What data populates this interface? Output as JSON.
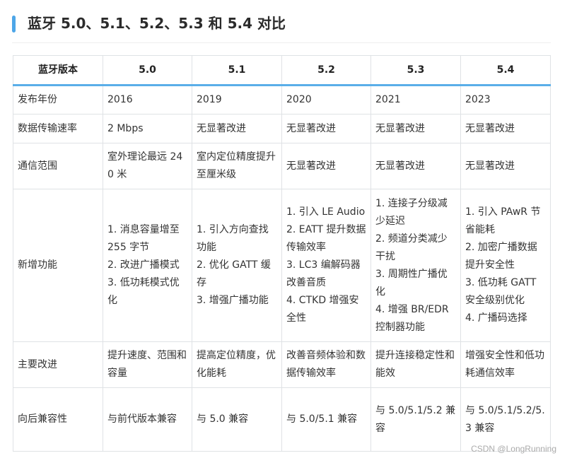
{
  "title": "蓝牙 5.0、5.1、5.2、5.3 和 5.4 对比",
  "table": {
    "headers": [
      "蓝牙版本",
      "5.0",
      "5.1",
      "5.2",
      "5.3",
      "5.4"
    ],
    "rows": [
      [
        "发布年份",
        "2016",
        "2019",
        "2020",
        "2021",
        "2023"
      ],
      [
        "数据传输速率",
        "2 Mbps",
        "无显著改进",
        "无显著改进",
        "无显著改进",
        "无显著改进"
      ],
      [
        "通信范围",
        "室外理论最远 240 米",
        "室内定位精度提升至厘米级",
        "无显著改进",
        "无显著改进",
        "无显著改进"
      ],
      [
        "新增功能",
        "1. 消息容量增至 255 字节\n2. 改进广播模式\n3. 低功耗模式优化",
        "1. 引入方向查找功能\n2. 优化 GATT 缓存\n3. 增强广播功能",
        "1. 引入 LE Audio\n2. EATT 提升数据传输效率\n3. LC3 编解码器改善音质\n4. CTKD 增强安全性",
        "1. 连接子分级减少延迟\n2. 频道分类减少干扰\n3. 周期性广播优化\n4. 增强 BR/EDR 控制器功能",
        "1. 引入 PAwR 节省能耗\n2. 加密广播数据提升安全性\n3. 低功耗 GATT 安全级别优化\n4. 广播码选择"
      ],
      [
        "主要改进",
        "提升速度、范围和容量",
        "提高定位精度，优化能耗",
        "改善音频体验和数据传输效率",
        "提升连接稳定性和能效",
        "增强安全性和低功耗通信效率"
      ],
      [
        "向后兼容性",
        "与前代版本兼容",
        "与 5.0 兼容",
        "与 5.0/5.1 兼容",
        "与 5.0/5.1/5.2 兼容",
        "与 5.0/5.1/5.2/5.3 兼容"
      ]
    ]
  },
  "watermark": "CSDN @LongRunning",
  "colors": {
    "accent": "#4da6e8",
    "border": "#dfe2e5"
  }
}
